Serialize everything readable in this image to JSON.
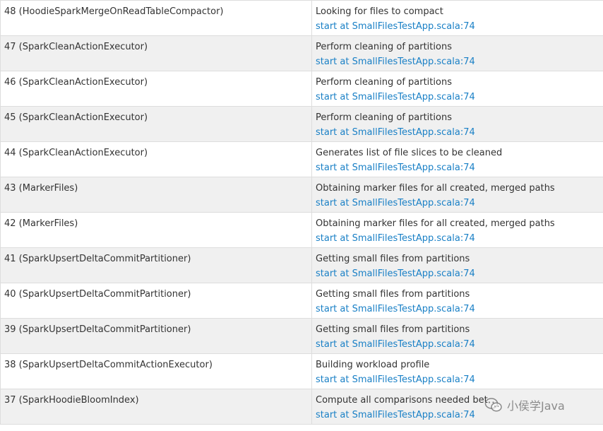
{
  "jobs": [
    {
      "id_name": "48 (HoodieSparkMergeOnReadTableCompactor)",
      "description": "Looking for files to compact",
      "callsite": "start at SmallFilesTestApp.scala:74"
    },
    {
      "id_name": "47 (SparkCleanActionExecutor)",
      "description": "Perform cleaning of partitions",
      "callsite": "start at SmallFilesTestApp.scala:74"
    },
    {
      "id_name": "46 (SparkCleanActionExecutor)",
      "description": "Perform cleaning of partitions",
      "callsite": "start at SmallFilesTestApp.scala:74"
    },
    {
      "id_name": "45 (SparkCleanActionExecutor)",
      "description": "Perform cleaning of partitions",
      "callsite": "start at SmallFilesTestApp.scala:74"
    },
    {
      "id_name": "44 (SparkCleanActionExecutor)",
      "description": "Generates list of file slices to be cleaned",
      "callsite": "start at SmallFilesTestApp.scala:74"
    },
    {
      "id_name": "43 (MarkerFiles)",
      "description": "Obtaining marker files for all created, merged paths",
      "callsite": "start at SmallFilesTestApp.scala:74"
    },
    {
      "id_name": "42 (MarkerFiles)",
      "description": "Obtaining marker files for all created, merged paths",
      "callsite": "start at SmallFilesTestApp.scala:74"
    },
    {
      "id_name": "41 (SparkUpsertDeltaCommitPartitioner)",
      "description": "Getting small files from partitions",
      "callsite": "start at SmallFilesTestApp.scala:74"
    },
    {
      "id_name": "40 (SparkUpsertDeltaCommitPartitioner)",
      "description": "Getting small files from partitions",
      "callsite": "start at SmallFilesTestApp.scala:74"
    },
    {
      "id_name": "39 (SparkUpsertDeltaCommitPartitioner)",
      "description": "Getting small files from partitions",
      "callsite": "start at SmallFilesTestApp.scala:74"
    },
    {
      "id_name": "38 (SparkUpsertDeltaCommitActionExecutor)",
      "description": "Building workload profile",
      "callsite": "start at SmallFilesTestApp.scala:74"
    },
    {
      "id_name": "37 (SparkHoodieBloomIndex)",
      "description": "Compute all comparisons needed bet",
      "callsite": "start at SmallFilesTestApp.scala:74"
    }
  ],
  "watermark": {
    "icon": "wechat-icon",
    "text": "小侯学Java"
  },
  "colors": {
    "link": "#1a80c6",
    "text": "#333333",
    "row_alt": "#f0f0f0",
    "border": "#dddddd"
  }
}
